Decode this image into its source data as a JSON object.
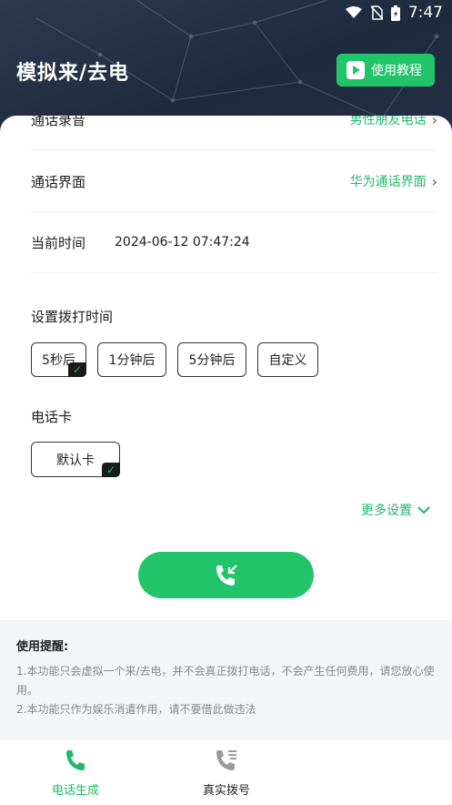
{
  "status": {
    "time": "7:47"
  },
  "header": {
    "title": "模拟来/去电",
    "tutorial_label": "使用教程"
  },
  "settings": {
    "record": {
      "label": "通话录音",
      "value": "男性朋友电话"
    },
    "ui": {
      "label": "通话界面",
      "value": "华为通话界面"
    },
    "current_time": {
      "label": "当前时间",
      "value": "2024-06-12 07:47:24"
    }
  },
  "dial_time": {
    "title": "设置拨打时间",
    "options": [
      "5秒后",
      "1分钟后",
      "5分钟后",
      "自定义"
    ],
    "selected": "5秒后"
  },
  "sim": {
    "title": "电话卡",
    "option": "默认卡"
  },
  "more_settings": "更多设置",
  "notice": {
    "title": "使用提醒:",
    "line1": "1.本功能只会虚拟一个来/去电，并不会真正拨打电话，不会产生任何费用，请您放心使用。",
    "line2": "2.本功能只作为娱乐消遣作用，请不要借此做违法"
  },
  "tabs": [
    {
      "label": "电话生成",
      "active": true
    },
    {
      "label": "真实拨号",
      "active": false
    }
  ],
  "colors": {
    "accent": "#22c46a",
    "header_bg": "#243046"
  }
}
